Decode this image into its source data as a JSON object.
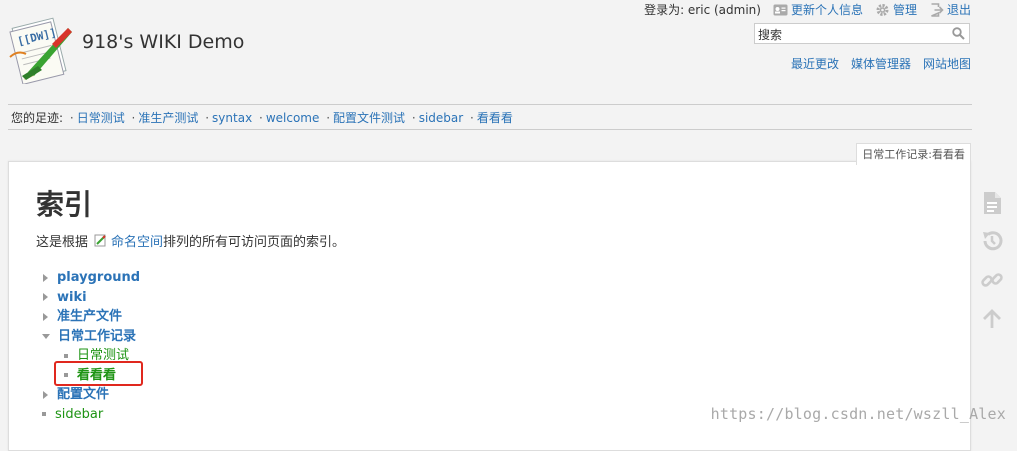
{
  "site": {
    "title": "918's WIKI Demo"
  },
  "user_tools": {
    "logged_in_label": "登录为: eric (admin)",
    "profile": "更新个人信息",
    "admin": "管理",
    "logout": "退出"
  },
  "search": {
    "value": "搜索"
  },
  "site_tools": {
    "recent": "最近更改",
    "media": "媒体管理器",
    "sitemap": "网站地图"
  },
  "breadcrumbs": {
    "label": "您的足迹:",
    "items": [
      "日常测试",
      "准生产测试",
      "syntax",
      "welcome",
      "配置文件测试",
      "sidebar",
      "看看看"
    ]
  },
  "page_id": "日常工作记录:看看看",
  "content": {
    "heading": "索引",
    "intro_before": "这是根据",
    "intro_link": "命名空间",
    "intro_after": "排列的所有可访问页面的索引。"
  },
  "tree": {
    "playground": "playground",
    "wiki": "wiki",
    "prod": "准生产文件",
    "daily": "日常工作记录",
    "daily_test": "日常测试",
    "look": "看看看",
    "config": "配置文件",
    "sidebar": "sidebar"
  },
  "watermark": "https://blog.csdn.net/wszll_Alex",
  "colors": {
    "link": "#2b73b7",
    "page_link": "#1e9414",
    "highlight": "#e0281e"
  }
}
